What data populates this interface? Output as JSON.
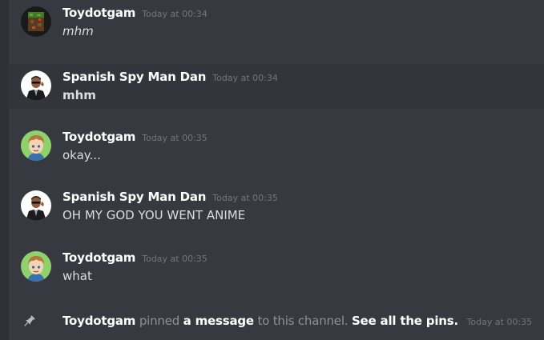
{
  "messages": [
    {
      "author": "Toydotgam",
      "timestamp": "Today at 00:34",
      "text": "mhm",
      "avatar": "minecraft-block-avatar"
    },
    {
      "author": "Spanish Spy Man Dan",
      "timestamp": "Today at 00:34",
      "text": "mhm",
      "avatar": "suited-man-avatar"
    },
    {
      "author": "Toydotgam",
      "timestamp": "Today at 00:35",
      "text": "okay...",
      "avatar": "anime-boy-avatar"
    },
    {
      "author": "Spanish Spy Man Dan",
      "timestamp": "Today at 00:35",
      "text": "OH MY GOD YOU WENT ANIME",
      "avatar": "suited-man-avatar"
    },
    {
      "author": "Toydotgam",
      "timestamp": "Today at 00:35",
      "text": "what",
      "avatar": "anime-boy-avatar"
    }
  ],
  "system_message": {
    "icon": "pin-icon",
    "author": "Toydotgam",
    "action": "pinned",
    "link": "a message",
    "middle": "to this channel.",
    "see_all": "See all the pins.",
    "timestamp": "Today at 00:35"
  },
  "colors": {
    "background": "#36393f",
    "hover_row": "#32353b",
    "username": "#ffffff",
    "timestamp": "#72767d",
    "message_text": "#dcddde"
  }
}
